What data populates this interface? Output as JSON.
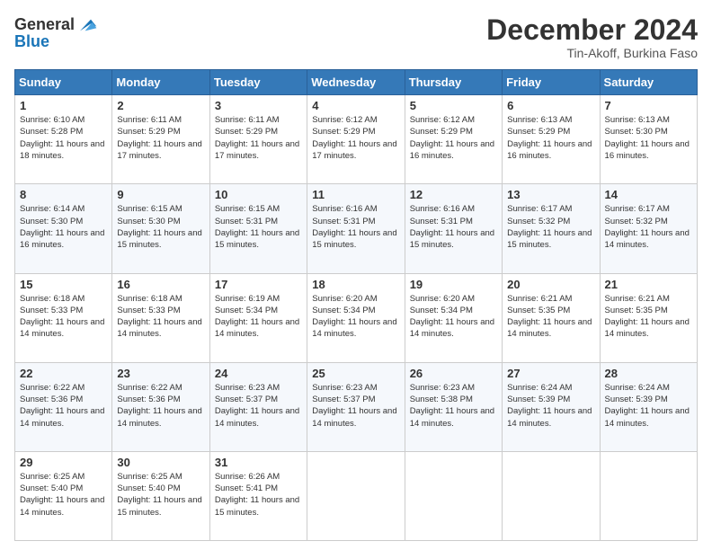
{
  "header": {
    "logo_line1": "General",
    "logo_line2": "Blue",
    "month": "December 2024",
    "location": "Tin-Akoff, Burkina Faso"
  },
  "days_of_week": [
    "Sunday",
    "Monday",
    "Tuesday",
    "Wednesday",
    "Thursday",
    "Friday",
    "Saturday"
  ],
  "weeks": [
    [
      {
        "day": "1",
        "sunrise": "6:10 AM",
        "sunset": "5:28 PM",
        "daylight": "11 hours and 18 minutes."
      },
      {
        "day": "2",
        "sunrise": "6:11 AM",
        "sunset": "5:29 PM",
        "daylight": "11 hours and 17 minutes."
      },
      {
        "day": "3",
        "sunrise": "6:11 AM",
        "sunset": "5:29 PM",
        "daylight": "11 hours and 17 minutes."
      },
      {
        "day": "4",
        "sunrise": "6:12 AM",
        "sunset": "5:29 PM",
        "daylight": "11 hours and 17 minutes."
      },
      {
        "day": "5",
        "sunrise": "6:12 AM",
        "sunset": "5:29 PM",
        "daylight": "11 hours and 16 minutes."
      },
      {
        "day": "6",
        "sunrise": "6:13 AM",
        "sunset": "5:29 PM",
        "daylight": "11 hours and 16 minutes."
      },
      {
        "day": "7",
        "sunrise": "6:13 AM",
        "sunset": "5:30 PM",
        "daylight": "11 hours and 16 minutes."
      }
    ],
    [
      {
        "day": "8",
        "sunrise": "6:14 AM",
        "sunset": "5:30 PM",
        "daylight": "11 hours and 16 minutes."
      },
      {
        "day": "9",
        "sunrise": "6:15 AM",
        "sunset": "5:30 PM",
        "daylight": "11 hours and 15 minutes."
      },
      {
        "day": "10",
        "sunrise": "6:15 AM",
        "sunset": "5:31 PM",
        "daylight": "11 hours and 15 minutes."
      },
      {
        "day": "11",
        "sunrise": "6:16 AM",
        "sunset": "5:31 PM",
        "daylight": "11 hours and 15 minutes."
      },
      {
        "day": "12",
        "sunrise": "6:16 AM",
        "sunset": "5:31 PM",
        "daylight": "11 hours and 15 minutes."
      },
      {
        "day": "13",
        "sunrise": "6:17 AM",
        "sunset": "5:32 PM",
        "daylight": "11 hours and 15 minutes."
      },
      {
        "day": "14",
        "sunrise": "6:17 AM",
        "sunset": "5:32 PM",
        "daylight": "11 hours and 14 minutes."
      }
    ],
    [
      {
        "day": "15",
        "sunrise": "6:18 AM",
        "sunset": "5:33 PM",
        "daylight": "11 hours and 14 minutes."
      },
      {
        "day": "16",
        "sunrise": "6:18 AM",
        "sunset": "5:33 PM",
        "daylight": "11 hours and 14 minutes."
      },
      {
        "day": "17",
        "sunrise": "6:19 AM",
        "sunset": "5:34 PM",
        "daylight": "11 hours and 14 minutes."
      },
      {
        "day": "18",
        "sunrise": "6:20 AM",
        "sunset": "5:34 PM",
        "daylight": "11 hours and 14 minutes."
      },
      {
        "day": "19",
        "sunrise": "6:20 AM",
        "sunset": "5:34 PM",
        "daylight": "11 hours and 14 minutes."
      },
      {
        "day": "20",
        "sunrise": "6:21 AM",
        "sunset": "5:35 PM",
        "daylight": "11 hours and 14 minutes."
      },
      {
        "day": "21",
        "sunrise": "6:21 AM",
        "sunset": "5:35 PM",
        "daylight": "11 hours and 14 minutes."
      }
    ],
    [
      {
        "day": "22",
        "sunrise": "6:22 AM",
        "sunset": "5:36 PM",
        "daylight": "11 hours and 14 minutes."
      },
      {
        "day": "23",
        "sunrise": "6:22 AM",
        "sunset": "5:36 PM",
        "daylight": "11 hours and 14 minutes."
      },
      {
        "day": "24",
        "sunrise": "6:23 AM",
        "sunset": "5:37 PM",
        "daylight": "11 hours and 14 minutes."
      },
      {
        "day": "25",
        "sunrise": "6:23 AM",
        "sunset": "5:37 PM",
        "daylight": "11 hours and 14 minutes."
      },
      {
        "day": "26",
        "sunrise": "6:23 AM",
        "sunset": "5:38 PM",
        "daylight": "11 hours and 14 minutes."
      },
      {
        "day": "27",
        "sunrise": "6:24 AM",
        "sunset": "5:39 PM",
        "daylight": "11 hours and 14 minutes."
      },
      {
        "day": "28",
        "sunrise": "6:24 AM",
        "sunset": "5:39 PM",
        "daylight": "11 hours and 14 minutes."
      }
    ],
    [
      {
        "day": "29",
        "sunrise": "6:25 AM",
        "sunset": "5:40 PM",
        "daylight": "11 hours and 14 minutes."
      },
      {
        "day": "30",
        "sunrise": "6:25 AM",
        "sunset": "5:40 PM",
        "daylight": "11 hours and 15 minutes."
      },
      {
        "day": "31",
        "sunrise": "6:26 AM",
        "sunset": "5:41 PM",
        "daylight": "11 hours and 15 minutes."
      },
      null,
      null,
      null,
      null
    ]
  ],
  "labels": {
    "sunrise": "Sunrise:",
    "sunset": "Sunset:",
    "daylight": "Daylight:"
  }
}
